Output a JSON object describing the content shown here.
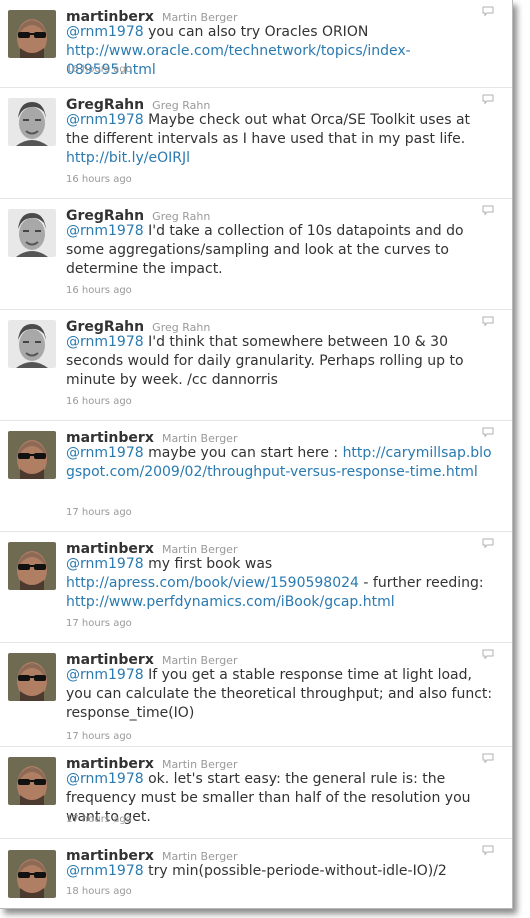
{
  "tweets": [
    {
      "screen_name": "martinberx",
      "full_name": "Martin Berger",
      "parts": [
        "@rnm1978",
        " you can also try Oracles ORION ",
        "http://www.oracle.com/technetwork/topics/index-089595.html"
      ],
      "time": "16 hours ago",
      "avatar": "martin-avatar"
    },
    {
      "screen_name": "GregRahn",
      "full_name": "Greg Rahn",
      "parts": [
        "@rnm1978",
        " Maybe check out what Orca/SE Toolkit uses at the different intervals as I have used that in my past life. ",
        "http://bit.ly/eOIRJl"
      ],
      "time": "16 hours ago",
      "avatar": "greg-avatar"
    },
    {
      "screen_name": "GregRahn",
      "full_name": "Greg Rahn",
      "parts": [
        "@rnm1978",
        " I'd take a collection of 10s datapoints and do some aggregations/sampling and look at the curves to determine the impact."
      ],
      "time": "16 hours ago",
      "avatar": "greg-avatar"
    },
    {
      "screen_name": "GregRahn",
      "full_name": "Greg Rahn",
      "parts": [
        "@rnm1978",
        " I'd think that somewhere between 10 & 30 seconds would for daily granularity. Perhaps rolling up to minute by week. /cc dannorris"
      ],
      "time": "16 hours ago",
      "avatar": "greg-avatar"
    },
    {
      "screen_name": "martinberx",
      "full_name": "Martin Berger",
      "parts": [
        "@rnm1978",
        " maybe you can start here : ",
        "http://carymillsap.blogspot.com/2009/02/throughput-versus-response-time.html"
      ],
      "time": "17 hours ago",
      "avatar": "martin-avatar"
    },
    {
      "screen_name": "martinberx",
      "full_name": "Martin Berger",
      "parts": [
        "@rnm1978",
        " my first book was ",
        "http://apress.com/book/view/1590598024",
        " - further reeding: ",
        "http://www.perfdynamics.com/iBook/gcap.html"
      ],
      "time": "17 hours ago",
      "avatar": "martin-avatar"
    },
    {
      "screen_name": "martinberx",
      "full_name": "Martin Berger",
      "parts": [
        "@rnm1978",
        " If you get a stable response time at light load, you can calculate the theoretical throughput; and also funct: response_time(IO)"
      ],
      "time": "17 hours ago",
      "avatar": "martin-avatar"
    },
    {
      "screen_name": "martinberx",
      "full_name": "Martin Berger",
      "parts": [
        "@rnm1978",
        " ok. let's start easy: the general rule is: the frequency must be smaller than half of the resolution you want to get."
      ],
      "time": "17 hours ago",
      "avatar": "martin-avatar"
    },
    {
      "screen_name": "martinberx",
      "full_name": "Martin Berger",
      "parts": [
        "@rnm1978",
        " try min(possible-periode-without-idle-IO)/2"
      ],
      "time": "18 hours ago",
      "avatar": "martin-avatar"
    }
  ],
  "colors": {
    "link": "#2a7ab0",
    "meta": "#999999",
    "text": "#333333"
  }
}
